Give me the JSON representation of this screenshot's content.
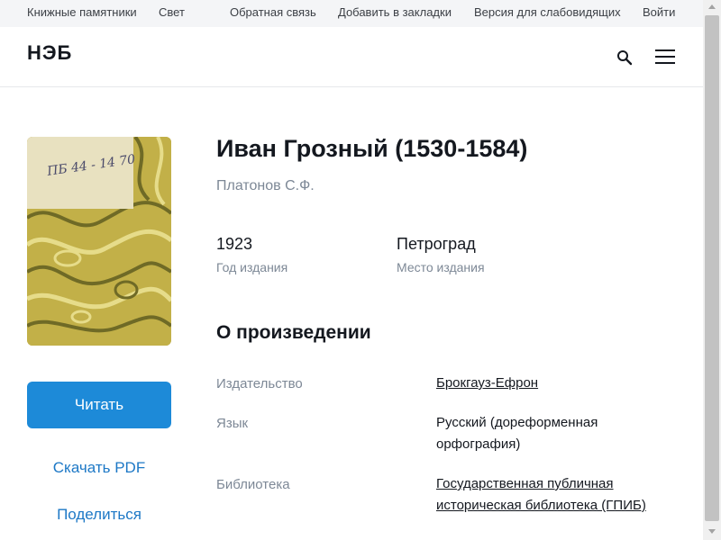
{
  "topbar": {
    "links": [
      "Книжные памятники",
      "Свет",
      "Обратная связь",
      "Добавить в закладки",
      "Версия для слабовидящих",
      "Войти"
    ]
  },
  "header": {
    "logo": "НЭБ",
    "icons": [
      "search-icon",
      "menu-icon"
    ]
  },
  "book": {
    "title": "Иван Грозный (1530-1584)",
    "author": "Платонов С.Ф.",
    "cover_inscription": "ПБ 44 - 14 70",
    "year": {
      "value": "1923",
      "label": "Год издания"
    },
    "place": {
      "value": "Петроград",
      "label": "Место издания"
    }
  },
  "actions": {
    "read": "Читать",
    "download": "Скачать PDF",
    "share": "Поделиться"
  },
  "about": {
    "title": "О произведении",
    "rows": [
      {
        "label": "Издательство",
        "value": "Брокгауз-Ефрон"
      },
      {
        "label": "Язык",
        "value": "Русский (дореформенная орфография)"
      },
      {
        "label": "Библиотека",
        "value": "Государственная публичная историческая библиотека (ГПИБ)"
      }
    ]
  },
  "colors": {
    "accent": "#1d8ad8",
    "link": "#1d78c6",
    "muted": "#7d8896",
    "cover": "#b9a63c"
  }
}
